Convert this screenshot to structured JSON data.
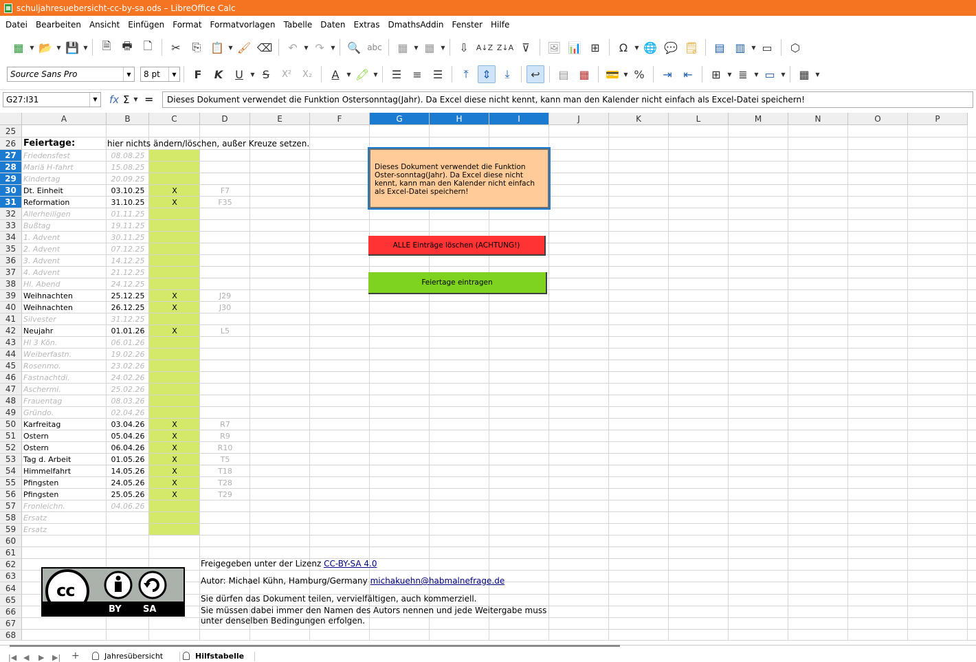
{
  "window": {
    "title": "schuljahresuebersicht-cc-by-sa.ods – LibreOffice Calc"
  },
  "menu": [
    "Datei",
    "Bearbeiten",
    "Ansicht",
    "Einfügen",
    "Format",
    "Formatvorlagen",
    "Tabelle",
    "Daten",
    "Extras",
    "DmathsAddin",
    "Fenster",
    "Hilfe"
  ],
  "toolbar": {
    "font_name": "Source Sans Pro",
    "font_size": "8 pt"
  },
  "formula_bar": {
    "name_box": "G27:I31",
    "content": "Dieses Dokument verwendet die Funktion Ostersonntag(Jahr). Da Excel diese nicht kennt, kann man den Kalender nicht einfach als Excel-Datei speichern!"
  },
  "columns": [
    "A",
    "B",
    "C",
    "D",
    "E",
    "F",
    "G",
    "H",
    "I",
    "J",
    "K",
    "L",
    "M",
    "N",
    "O",
    "P"
  ],
  "rows": [
    "25",
    "26",
    "27",
    "28",
    "29",
    "30",
    "31",
    "32",
    "33",
    "34",
    "35",
    "36",
    "37",
    "38",
    "39",
    "40",
    "41",
    "42",
    "43",
    "44",
    "45",
    "46",
    "47",
    "48",
    "49",
    "50",
    "51",
    "52",
    "53",
    "54",
    "55",
    "56",
    "57",
    "58",
    "59",
    "60",
    "61",
    "62",
    "63",
    "64",
    "65",
    "66",
    "67",
    "68"
  ],
  "header_row": {
    "label": "Feiertage:",
    "note": "hier nichts ändern/löschen, außer Kreuze setzen."
  },
  "holidays": [
    {
      "name": "Friedensfest",
      "date": "08.08.25",
      "x": "",
      "ref": "",
      "active": false
    },
    {
      "name": "Mariä H-fahrt",
      "date": "15.08.25",
      "x": "",
      "ref": "",
      "active": false
    },
    {
      "name": "Kindertag",
      "date": "20.09.25",
      "x": "",
      "ref": "",
      "active": false
    },
    {
      "name": "Dt. Einheit",
      "date": "03.10.25",
      "x": "X",
      "ref": "F7",
      "active": true
    },
    {
      "name": "Reformation",
      "date": "31.10.25",
      "x": "X",
      "ref": "F35",
      "active": true
    },
    {
      "name": "Allerheiligen",
      "date": "01.11.25",
      "x": "",
      "ref": "",
      "active": false
    },
    {
      "name": "Bußtag",
      "date": "19.11.25",
      "x": "",
      "ref": "",
      "active": false
    },
    {
      "name": "1. Advent",
      "date": "30.11.25",
      "x": "",
      "ref": "",
      "active": false
    },
    {
      "name": "2. Advent",
      "date": "07.12.25",
      "x": "",
      "ref": "",
      "active": false
    },
    {
      "name": "3. Advent",
      "date": "14.12.25",
      "x": "",
      "ref": "",
      "active": false
    },
    {
      "name": "4. Advent",
      "date": "21.12.25",
      "x": "",
      "ref": "",
      "active": false
    },
    {
      "name": "Hl. Abend",
      "date": "24.12.25",
      "x": "",
      "ref": "",
      "active": false
    },
    {
      "name": "Weihnachten",
      "date": "25.12.25",
      "x": "X",
      "ref": "J29",
      "active": true
    },
    {
      "name": "Weihnachten",
      "date": "26.12.25",
      "x": "X",
      "ref": "J30",
      "active": true
    },
    {
      "name": "Silvester",
      "date": "31.12.25",
      "x": "",
      "ref": "",
      "active": false
    },
    {
      "name": "Neujahr",
      "date": "01.01.26",
      "x": "X",
      "ref": "L5",
      "active": true
    },
    {
      "name": "Hl 3 Kön.",
      "date": "06.01.26",
      "x": "",
      "ref": "",
      "active": false
    },
    {
      "name": "Weiberfastn.",
      "date": "19.02.26",
      "x": "",
      "ref": "",
      "active": false
    },
    {
      "name": "Rosenmo.",
      "date": "23.02.26",
      "x": "",
      "ref": "",
      "active": false
    },
    {
      "name": "Fastnachtdi.",
      "date": "24.02.26",
      "x": "",
      "ref": "",
      "active": false
    },
    {
      "name": "Aschermi.",
      "date": "25.02.26",
      "x": "",
      "ref": "",
      "active": false
    },
    {
      "name": "Frauentag",
      "date": "08.03.26",
      "x": "",
      "ref": "",
      "active": false
    },
    {
      "name": "Gründo.",
      "date": "02.04.26",
      "x": "",
      "ref": "",
      "active": false
    },
    {
      "name": "Karfreitag",
      "date": "03.04.26",
      "x": "X",
      "ref": "R7",
      "active": true
    },
    {
      "name": "Ostern",
      "date": "05.04.26",
      "x": "X",
      "ref": "R9",
      "active": true
    },
    {
      "name": "Ostern",
      "date": "06.04.26",
      "x": "X",
      "ref": "R10",
      "active": true
    },
    {
      "name": "Tag d. Arbeit",
      "date": "01.05.26",
      "x": "X",
      "ref": "T5",
      "active": true
    },
    {
      "name": "Himmelfahrt",
      "date": "14.05.26",
      "x": "X",
      "ref": "T18",
      "active": true
    },
    {
      "name": "Pfingsten",
      "date": "24.05.26",
      "x": "X",
      "ref": "T28",
      "active": true
    },
    {
      "name": "Pfingsten",
      "date": "25.05.26",
      "x": "X",
      "ref": "T29",
      "active": true
    },
    {
      "name": "Fronleichn.",
      "date": "04.06.26",
      "x": "",
      "ref": "",
      "active": false
    },
    {
      "name": "Ersatz",
      "date": "",
      "x": "",
      "ref": "",
      "active": false
    },
    {
      "name": "Ersatz",
      "date": "",
      "x": "",
      "ref": "",
      "active": false
    }
  ],
  "note_box": "Dieses Dokument verwendet die Funktion Oster-sonntag(Jahr). Da Excel diese nicht kennt, kann man den Kalender nicht einfach als Excel-Datei speichern!",
  "buttons": {
    "delete_all": "ALLE Einträge löschen (ACHTUNG!)",
    "insert_holidays": "Feiertage eintragen"
  },
  "license": {
    "line1_prefix": "Freigegeben unter der Lizenz ",
    "line1_link": "CC-BY-SA 4.0",
    "line2_prefix": "Autor: Michael Kühn, Hamburg/Germany ",
    "line2_link": "michakuehn@habmalnefrage.de",
    "line3": "Sie dürfen das Dokument teilen, vervielfältigen, auch kommerziell.",
    "line4": "Sie müssen dabei immer den Namen des Autors nennen und jede Weitergabe muss",
    "line5": "unter denselben Bedingungen erfolgen.",
    "logo_cc": "cc",
    "logo_by": "BY",
    "logo_sa": "SA"
  },
  "sheet_tabs": [
    {
      "label": "Jahresübersicht",
      "active": false
    },
    {
      "label": "Hilfstabelle",
      "active": true
    }
  ],
  "colors": {
    "title_bar": "#f47421",
    "green_band": "#d4e86a",
    "note_fill": "#ffcc99",
    "delete_button": "#ff3333",
    "holiday_button": "#7ed321",
    "selection": "#1a7bd1"
  }
}
